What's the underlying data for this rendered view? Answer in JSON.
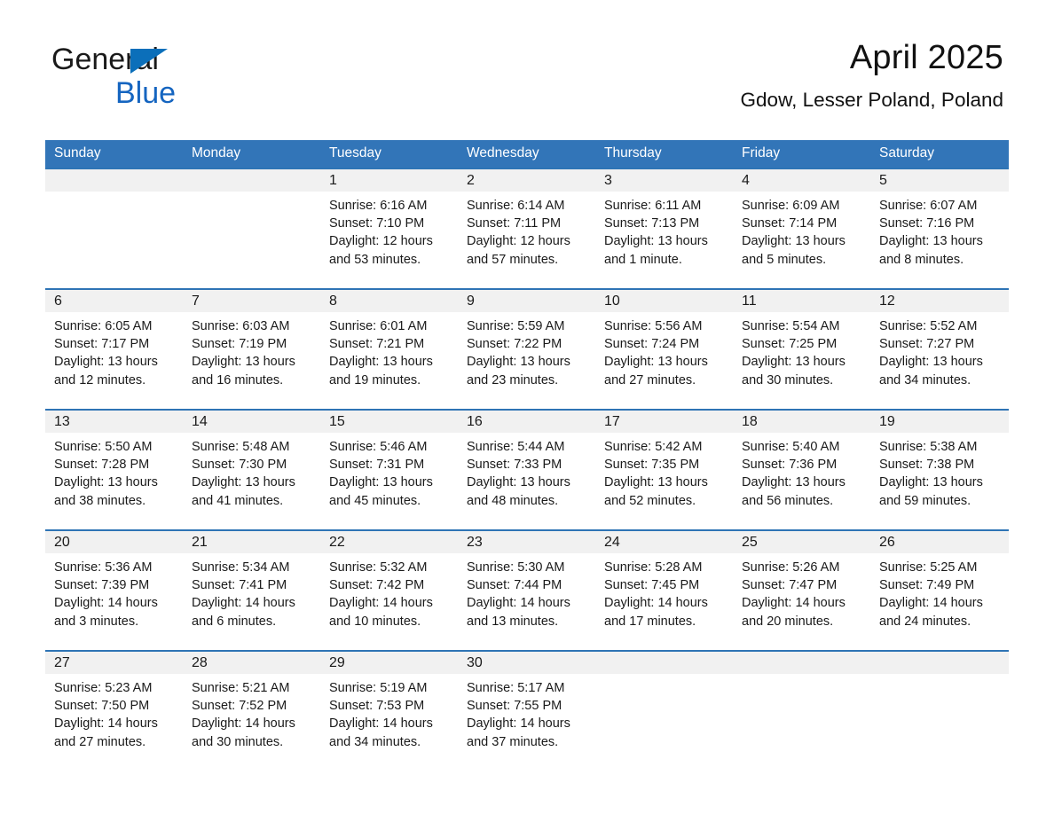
{
  "brand": {
    "word1": "General",
    "word2": "Blue",
    "triangle_icon": "brand-triangle-icon",
    "accent_color": "#1565c0",
    "triangle_color": "#0b6fba"
  },
  "header": {
    "month_title": "April 2025",
    "location": "Gdow, Lesser Poland, Poland"
  },
  "theme": {
    "header_blue": "#3275b8",
    "row_rule_blue": "#2e74b5",
    "daynum_band": "#f1f1f1",
    "text": "#1a1a1a"
  },
  "columns": [
    "Sunday",
    "Monday",
    "Tuesday",
    "Wednesday",
    "Thursday",
    "Friday",
    "Saturday"
  ],
  "weeks": [
    {
      "days": [
        {
          "date": "",
          "lines": []
        },
        {
          "date": "",
          "lines": []
        },
        {
          "date": "1",
          "lines": [
            "Sunrise: 6:16 AM",
            "Sunset: 7:10 PM",
            "Daylight: 12 hours",
            "and 53 minutes."
          ]
        },
        {
          "date": "2",
          "lines": [
            "Sunrise: 6:14 AM",
            "Sunset: 7:11 PM",
            "Daylight: 12 hours",
            "and 57 minutes."
          ]
        },
        {
          "date": "3",
          "lines": [
            "Sunrise: 6:11 AM",
            "Sunset: 7:13 PM",
            "Daylight: 13 hours",
            "and 1 minute."
          ]
        },
        {
          "date": "4",
          "lines": [
            "Sunrise: 6:09 AM",
            "Sunset: 7:14 PM",
            "Daylight: 13 hours",
            "and 5 minutes."
          ]
        },
        {
          "date": "5",
          "lines": [
            "Sunrise: 6:07 AM",
            "Sunset: 7:16 PM",
            "Daylight: 13 hours",
            "and 8 minutes."
          ]
        }
      ]
    },
    {
      "days": [
        {
          "date": "6",
          "lines": [
            "Sunrise: 6:05 AM",
            "Sunset: 7:17 PM",
            "Daylight: 13 hours",
            "and 12 minutes."
          ]
        },
        {
          "date": "7",
          "lines": [
            "Sunrise: 6:03 AM",
            "Sunset: 7:19 PM",
            "Daylight: 13 hours",
            "and 16 minutes."
          ]
        },
        {
          "date": "8",
          "lines": [
            "Sunrise: 6:01 AM",
            "Sunset: 7:21 PM",
            "Daylight: 13 hours",
            "and 19 minutes."
          ]
        },
        {
          "date": "9",
          "lines": [
            "Sunrise: 5:59 AM",
            "Sunset: 7:22 PM",
            "Daylight: 13 hours",
            "and 23 minutes."
          ]
        },
        {
          "date": "10",
          "lines": [
            "Sunrise: 5:56 AM",
            "Sunset: 7:24 PM",
            "Daylight: 13 hours",
            "and 27 minutes."
          ]
        },
        {
          "date": "11",
          "lines": [
            "Sunrise: 5:54 AM",
            "Sunset: 7:25 PM",
            "Daylight: 13 hours",
            "and 30 minutes."
          ]
        },
        {
          "date": "12",
          "lines": [
            "Sunrise: 5:52 AM",
            "Sunset: 7:27 PM",
            "Daylight: 13 hours",
            "and 34 minutes."
          ]
        }
      ]
    },
    {
      "days": [
        {
          "date": "13",
          "lines": [
            "Sunrise: 5:50 AM",
            "Sunset: 7:28 PM",
            "Daylight: 13 hours",
            "and 38 minutes."
          ]
        },
        {
          "date": "14",
          "lines": [
            "Sunrise: 5:48 AM",
            "Sunset: 7:30 PM",
            "Daylight: 13 hours",
            "and 41 minutes."
          ]
        },
        {
          "date": "15",
          "lines": [
            "Sunrise: 5:46 AM",
            "Sunset: 7:31 PM",
            "Daylight: 13 hours",
            "and 45 minutes."
          ]
        },
        {
          "date": "16",
          "lines": [
            "Sunrise: 5:44 AM",
            "Sunset: 7:33 PM",
            "Daylight: 13 hours",
            "and 48 minutes."
          ]
        },
        {
          "date": "17",
          "lines": [
            "Sunrise: 5:42 AM",
            "Sunset: 7:35 PM",
            "Daylight: 13 hours",
            "and 52 minutes."
          ]
        },
        {
          "date": "18",
          "lines": [
            "Sunrise: 5:40 AM",
            "Sunset: 7:36 PM",
            "Daylight: 13 hours",
            "and 56 minutes."
          ]
        },
        {
          "date": "19",
          "lines": [
            "Sunrise: 5:38 AM",
            "Sunset: 7:38 PM",
            "Daylight: 13 hours",
            "and 59 minutes."
          ]
        }
      ]
    },
    {
      "days": [
        {
          "date": "20",
          "lines": [
            "Sunrise: 5:36 AM",
            "Sunset: 7:39 PM",
            "Daylight: 14 hours",
            "and 3 minutes."
          ]
        },
        {
          "date": "21",
          "lines": [
            "Sunrise: 5:34 AM",
            "Sunset: 7:41 PM",
            "Daylight: 14 hours",
            "and 6 minutes."
          ]
        },
        {
          "date": "22",
          "lines": [
            "Sunrise: 5:32 AM",
            "Sunset: 7:42 PM",
            "Daylight: 14 hours",
            "and 10 minutes."
          ]
        },
        {
          "date": "23",
          "lines": [
            "Sunrise: 5:30 AM",
            "Sunset: 7:44 PM",
            "Daylight: 14 hours",
            "and 13 minutes."
          ]
        },
        {
          "date": "24",
          "lines": [
            "Sunrise: 5:28 AM",
            "Sunset: 7:45 PM",
            "Daylight: 14 hours",
            "and 17 minutes."
          ]
        },
        {
          "date": "25",
          "lines": [
            "Sunrise: 5:26 AM",
            "Sunset: 7:47 PM",
            "Daylight: 14 hours",
            "and 20 minutes."
          ]
        },
        {
          "date": "26",
          "lines": [
            "Sunrise: 5:25 AM",
            "Sunset: 7:49 PM",
            "Daylight: 14 hours",
            "and 24 minutes."
          ]
        }
      ]
    },
    {
      "days": [
        {
          "date": "27",
          "lines": [
            "Sunrise: 5:23 AM",
            "Sunset: 7:50 PM",
            "Daylight: 14 hours",
            "and 27 minutes."
          ]
        },
        {
          "date": "28",
          "lines": [
            "Sunrise: 5:21 AM",
            "Sunset: 7:52 PM",
            "Daylight: 14 hours",
            "and 30 minutes."
          ]
        },
        {
          "date": "29",
          "lines": [
            "Sunrise: 5:19 AM",
            "Sunset: 7:53 PM",
            "Daylight: 14 hours",
            "and 34 minutes."
          ]
        },
        {
          "date": "30",
          "lines": [
            "Sunrise: 5:17 AM",
            "Sunset: 7:55 PM",
            "Daylight: 14 hours",
            "and 37 minutes."
          ]
        },
        {
          "date": "",
          "lines": []
        },
        {
          "date": "",
          "lines": []
        },
        {
          "date": "",
          "lines": []
        }
      ]
    }
  ]
}
